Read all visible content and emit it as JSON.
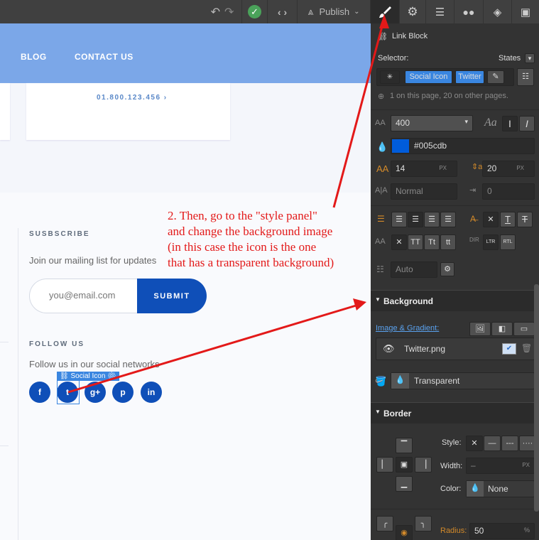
{
  "toolbar": {
    "publish_label": "Publish",
    "icons": [
      "undo-icon",
      "redo-icon",
      "check-icon",
      "code-icon",
      "publish-icon",
      "brush-icon",
      "gear-icon",
      "navigator-icon",
      "drops-icon",
      "box-icon",
      "assets-icon"
    ]
  },
  "canvas": {
    "nav": {
      "blog": "BLOG",
      "contact": "CONTACT US"
    },
    "phone": "01.800.123.456 ›",
    "subscribe_heading": "SUSBSCRIBE",
    "join_text": "Join our mailing list for updates",
    "email_placeholder": "you@email.com",
    "submit_label": "SUBMIT",
    "follow_heading": "FOLLOW US",
    "follow_text": "Follow us in our social networks",
    "selected_tag": "Social Icon",
    "social_icons": [
      "f",
      "t",
      "g+",
      "p",
      "in"
    ],
    "brand_color": "#0f4fb8"
  },
  "annotation": {
    "lines": [
      "2. Then, go to the \"style panel\"",
      "and change the background image",
      "(in this case the icon is the one",
      "that has a transparent background)"
    ],
    "color": "#e31919"
  },
  "panel": {
    "element_label": "Link Block",
    "selector_label": "Selector:",
    "states_label": "States",
    "class_1": "Social Icon",
    "class_2": "Twitter",
    "usage_text": "1 on this page, 20 on other pages.",
    "font_weight": "400",
    "font_preview": "Aa",
    "color_value": "#005cdb",
    "font_size": "14",
    "font_size_unit": "PX",
    "line_height": "20",
    "line_height_unit": "PX",
    "letter_spacing": "Normal",
    "text_indent": "0",
    "columns": "Auto",
    "text_transform": [
      "TT",
      "Tt",
      "tt"
    ],
    "dir_ltr": "LTR",
    "dir_rtl": "RTL",
    "background_heading": "Background",
    "image_gradient_label": "Image & Gradient:",
    "bg_image_name": "Twitter.png",
    "bg_color_value": "Transparent",
    "border_heading": "Border",
    "style_label": "Style:",
    "width_label": "Width:",
    "width_value": "–",
    "width_unit": "PX",
    "color_label": "Color:",
    "border_color_value": "None",
    "radius_label": "Radius:",
    "radius_value": "50",
    "radius_unit": "%"
  }
}
